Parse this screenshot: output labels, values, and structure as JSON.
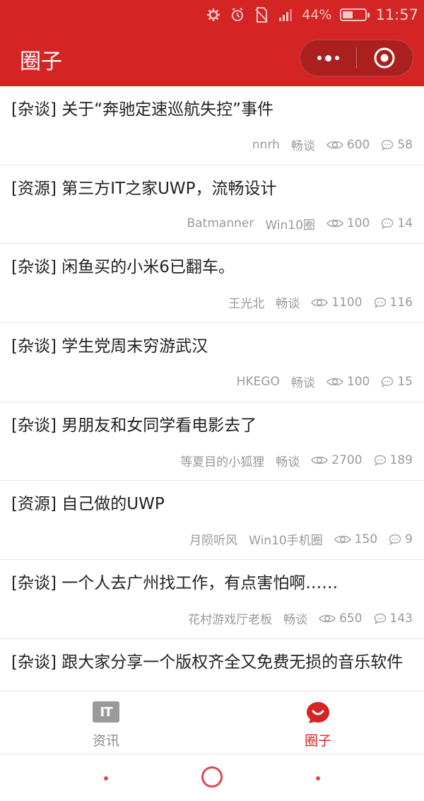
{
  "status_bar": {
    "battery_percent": "44%",
    "battery_level": 0.44,
    "time": "11:57",
    "icons": [
      "settings-gear-icon",
      "alarm-icon",
      "no-sim-icon",
      "signal-icon",
      "battery-icon"
    ]
  },
  "header": {
    "title": "圈子",
    "capsule": {
      "more_icon": "more-dots-icon",
      "close_icon": "target-circle-icon"
    }
  },
  "posts": [
    {
      "title": "[杂谈] 关于“奔驰定速巡航失控”事件",
      "author": "nnrh",
      "circle": "畅谈",
      "views": "600",
      "comments": "58"
    },
    {
      "title": "[资源] 第三方IT之家UWP，流畅设计",
      "author": "Batmanner",
      "circle": "Win10圈",
      "views": "100",
      "comments": "14"
    },
    {
      "title": "[杂谈] 闲鱼买的小米6已翻车。",
      "author": "王光北",
      "circle": "畅谈",
      "views": "1100",
      "comments": "116"
    },
    {
      "title": "[杂谈] 学生党周末穷游武汉",
      "author": "HKEGO",
      "circle": "畅谈",
      "views": "100",
      "comments": "15"
    },
    {
      "title": "[杂谈] 男朋友和女同学看电影去了",
      "author": "等夏目的小狐狸",
      "circle": "畅谈",
      "views": "2700",
      "comments": "189"
    },
    {
      "title": "[资源] 自己做的UWP",
      "author": "月陨听风",
      "circle": "Win10手机圈",
      "views": "150",
      "comments": "9"
    },
    {
      "title": "[杂谈] 一个人去广州找工作，有点害怕啊……",
      "author": "花村游戏厅老板",
      "circle": "畅谈",
      "views": "650",
      "comments": "143"
    },
    {
      "title": "[杂谈] 跟大家分享一个版权齐全又免费无损的音乐软件"
    }
  ],
  "tabbar": {
    "tabs": [
      {
        "label": "资讯",
        "icon": "it-logo-icon",
        "logo_text": "IT",
        "active": false
      },
      {
        "label": "圈子",
        "icon": "smile-bubble-icon",
        "active": true
      }
    ]
  },
  "colors": {
    "brand_red": "#d42424",
    "capsule_bg": "#ab1f1f",
    "meta_gray": "#9a9a9a",
    "nav_red": "#e0494c"
  }
}
